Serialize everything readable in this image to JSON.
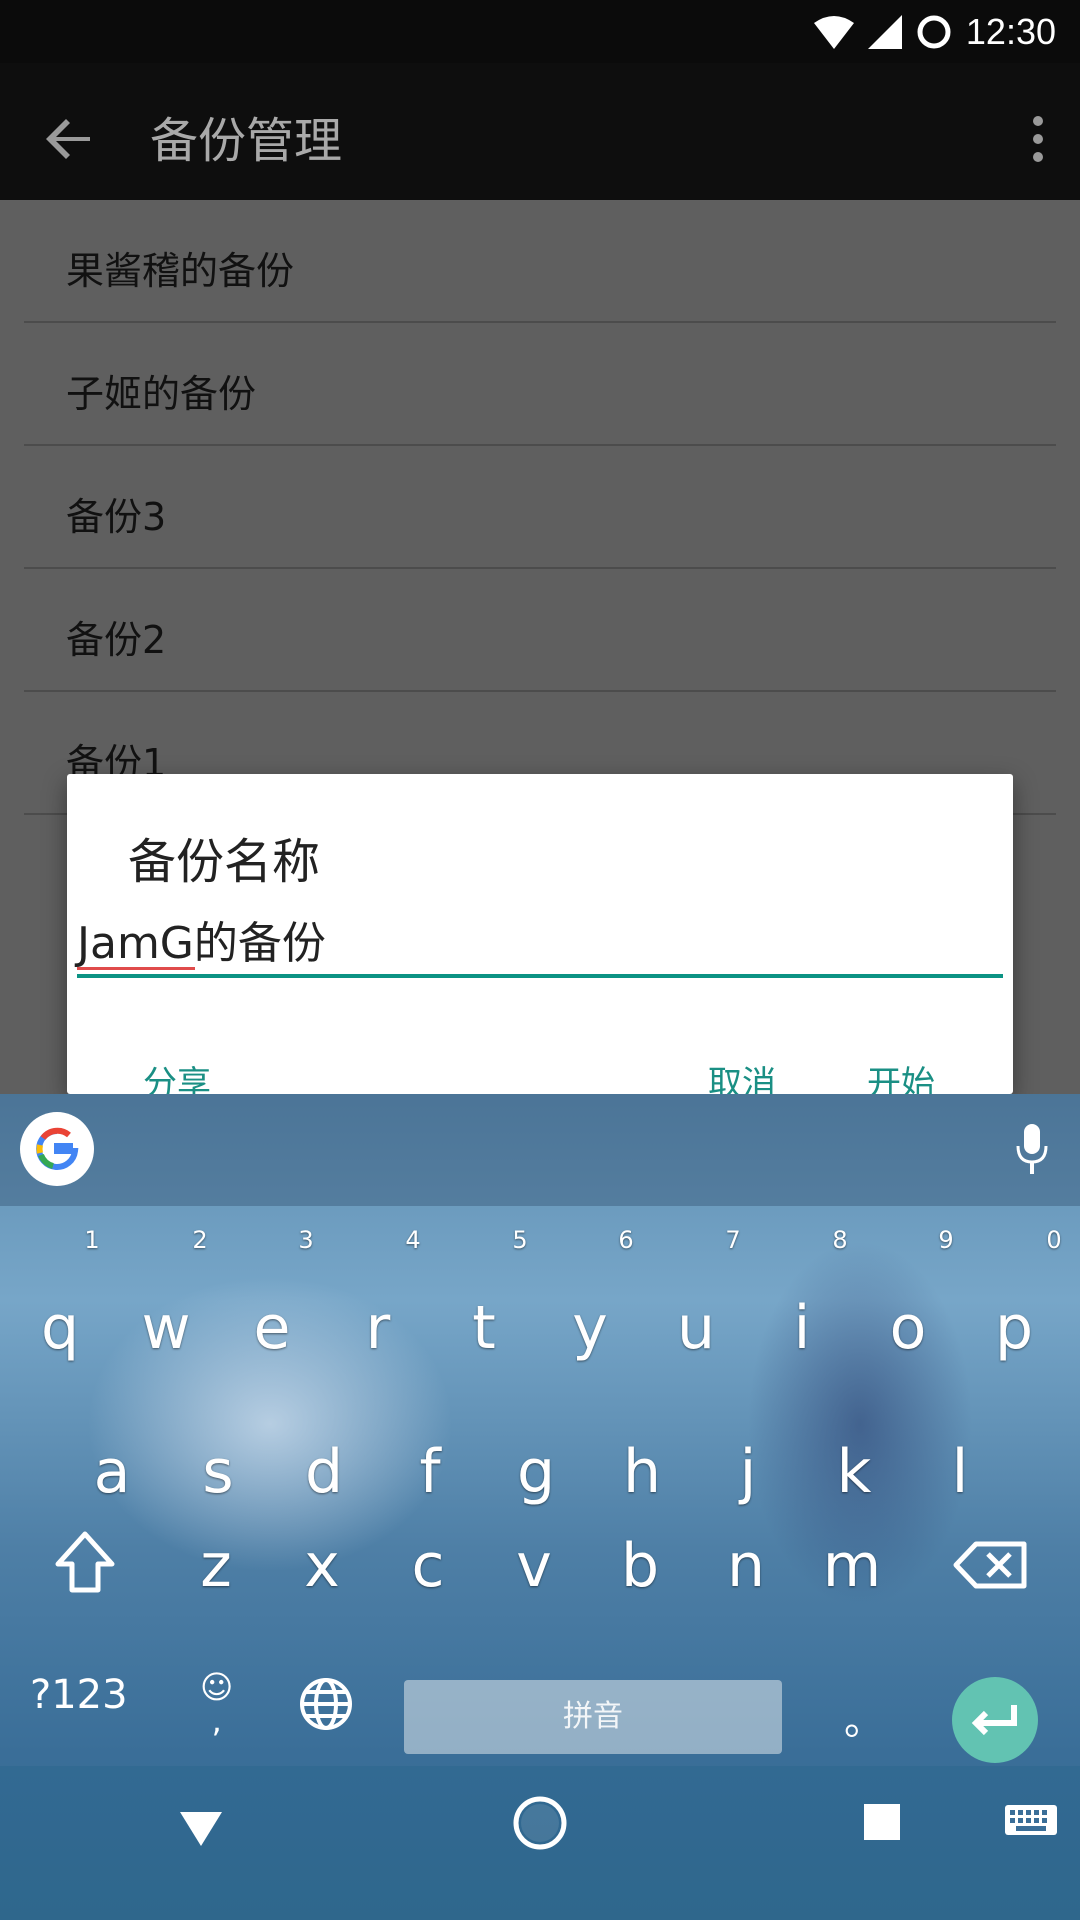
{
  "status_bar": {
    "time": "12:30"
  },
  "app_bar": {
    "title": "备份管理"
  },
  "list": {
    "items": [
      "果酱稽的备份",
      "子姬的备份",
      "备份3",
      "备份2",
      "备份1"
    ]
  },
  "dialog": {
    "title": "备份名称",
    "input_value": "JamG的备份",
    "buttons": {
      "share": "分享",
      "cancel": "取消",
      "start": "开始"
    }
  },
  "keyboard": {
    "row1": [
      "q",
      "w",
      "e",
      "r",
      "t",
      "y",
      "u",
      "i",
      "o",
      "p"
    ],
    "row1_numbers": [
      "1",
      "2",
      "3",
      "4",
      "5",
      "6",
      "7",
      "8",
      "9",
      "0"
    ],
    "row2": [
      "a",
      "s",
      "d",
      "f",
      "g",
      "h",
      "j",
      "k",
      "l"
    ],
    "row3": [
      "z",
      "x",
      "c",
      "v",
      "b",
      "n",
      "m"
    ],
    "symbols_label": "?123",
    "comma": ",",
    "space_label": "拼音",
    "period": "。"
  },
  "colors": {
    "accent": "#0c9384",
    "enter": "#62c3b2",
    "spell_error": "#e04b4b"
  }
}
